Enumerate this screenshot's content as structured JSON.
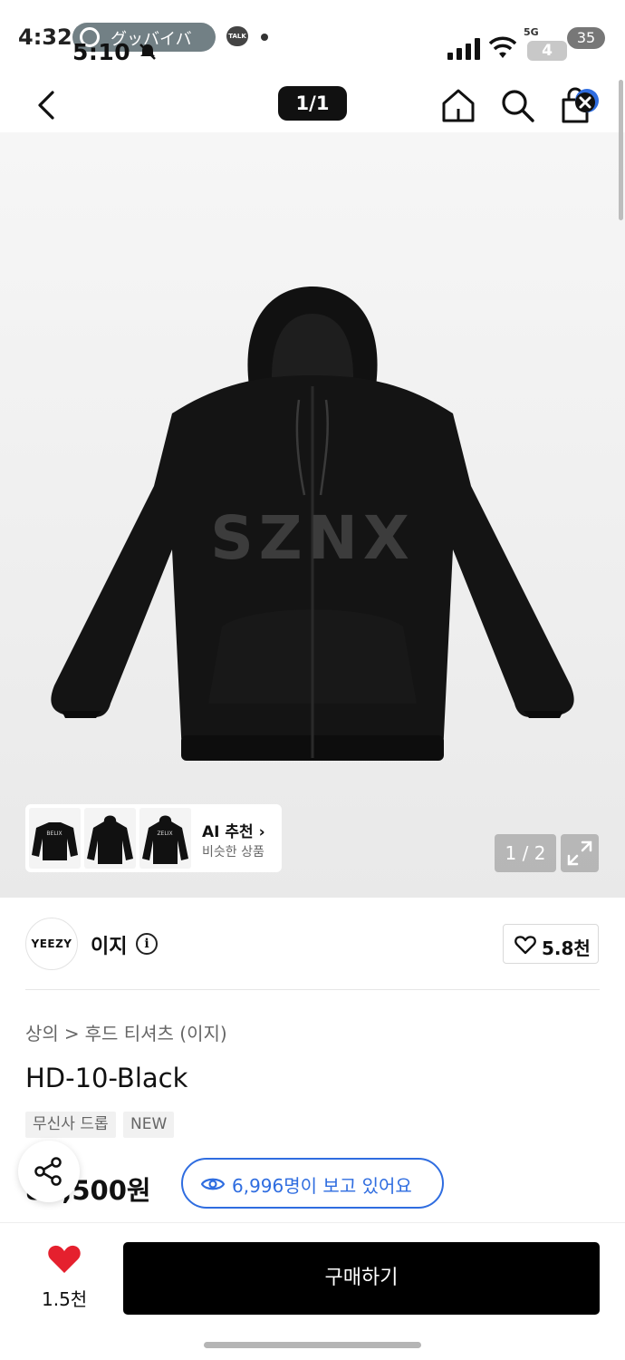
{
  "status_bar": {
    "time_back": "4:32",
    "time_front": "5:10",
    "app_pill": "グッバイバ",
    "talk": "TALK",
    "network": "5G",
    "battery_badge": "4",
    "battery_level": "35"
  },
  "nav": {
    "image_counter": "1/1"
  },
  "gallery": {
    "ai_title": "AI 추천",
    "ai_subtitle": "비슷한 상품",
    "image_index": "1 / 2",
    "print_text": "SZNX",
    "thumbnails": [
      "BELIX",
      "",
      "ZELIX"
    ]
  },
  "brand": {
    "logo_text": "YEEZY",
    "name": "이지",
    "like_count": "5.8천"
  },
  "product": {
    "breadcrumb_1": "상의",
    "breadcrumb_sep": ">",
    "breadcrumb_2": "후드 티셔츠 (이지)",
    "title": "HD-10-Black",
    "tags": [
      "무신사 드롭",
      "NEW"
    ],
    "price": "82,500원",
    "viewers": "6,996명이 보고 있어요"
  },
  "bottom_bar": {
    "wish_count": "1.5천",
    "buy_label": "구매하기"
  },
  "colors": {
    "accent_blue": "#2f6de0",
    "heart_red": "#e5202e",
    "buy_black": "#000000"
  }
}
